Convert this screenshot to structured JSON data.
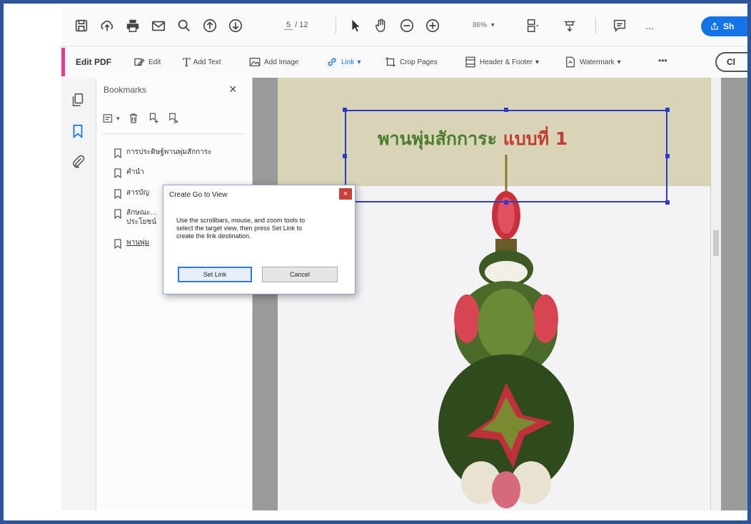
{
  "toolbar": {
    "page_current": "5",
    "page_total": "/ 12",
    "zoom": "86%",
    "share_label": "Sh",
    "more": "..."
  },
  "edit_toolbar": {
    "title": "Edit PDF",
    "edit": "Edit",
    "add_text": "Add Text",
    "add_image": "Add Image",
    "link": "Link",
    "crop_pages": "Crop Pages",
    "header_footer": "Header & Footer",
    "watermark": "Watermark",
    "more": "•••",
    "close": "Cl"
  },
  "bookmarks": {
    "header": "Bookmarks",
    "close": "×",
    "items": [
      {
        "label": "การประดิษฐ์พานพุ่มสักการะ"
      },
      {
        "label": "คำนำ"
      },
      {
        "label": "สารบัญ"
      },
      {
        "label": "ลักษณะ… ประโยชน์"
      },
      {
        "label": "พานพุ่ม"
      }
    ]
  },
  "document": {
    "heading_green": "พานพุ่มสักการะ",
    "heading_red": "แบบที่ 1"
  },
  "dialog": {
    "title": "Create Go to View",
    "close": "×",
    "message": "Use the scrollbars, mouse, and zoom tools to select the target view, then press Set Link to create the link destination.",
    "set_link": "Set Link",
    "cancel": "Cancel"
  },
  "colors": {
    "frame": "#2e5597",
    "accent": "#e23d8a",
    "link_blue": "#1473e6",
    "selection": "#2a3cc8",
    "heading_green": "#4d7d2f",
    "heading_red": "#c23a30"
  }
}
